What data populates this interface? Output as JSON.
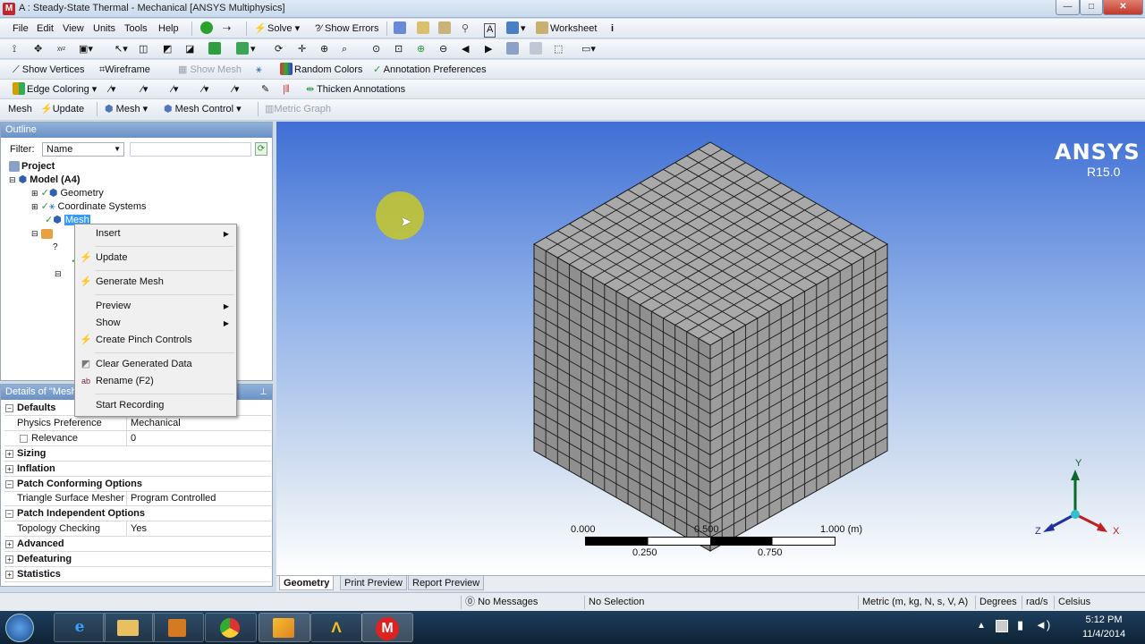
{
  "window": {
    "title": "A : Steady-State Thermal - Mechanical [ANSYS Multiphysics]",
    "minimize": "—",
    "maximize": "□",
    "close": "✕"
  },
  "menu": [
    "File",
    "Edit",
    "View",
    "Units",
    "Tools",
    "Help"
  ],
  "toolbar1": {
    "solve": "Solve",
    "show_errors": "Show Errors",
    "worksheet": "Worksheet"
  },
  "toolbar3": {
    "show_vertices": "Show Vertices",
    "wireframe": "Wireframe",
    "show_mesh": "Show Mesh",
    "random_colors": "Random Colors",
    "annotation_prefs": "Annotation Preferences"
  },
  "toolbar4": {
    "edge_coloring": "Edge Coloring",
    "thicken": "Thicken Annotations"
  },
  "toolbar5": {
    "mesh": "Mesh",
    "update": "Update",
    "mesh_dd": "Mesh",
    "mesh_control": "Mesh Control",
    "metric_graph": "Metric Graph"
  },
  "outline": {
    "header": "Outline",
    "filter_label": "Filter:",
    "filter_value": "Name",
    "tree": {
      "project": "Project",
      "model": "Model (A4)",
      "geometry": "Geometry",
      "coord": "Coordinate Systems",
      "mesh": "Mesh"
    }
  },
  "context_menu": {
    "insert": "Insert",
    "update": "Update",
    "generate_mesh": "Generate Mesh",
    "preview": "Preview",
    "show": "Show",
    "create_pinch": "Create Pinch Controls",
    "clear_generated": "Clear Generated Data",
    "rename": "Rename (F2)",
    "start_recording": "Start Recording"
  },
  "details": {
    "header": "Details of \"Mesh\"",
    "rows": [
      {
        "label": "Defaults",
        "group": true,
        "sign": "−"
      },
      {
        "label": "Physics Preference",
        "value": "Mechanical"
      },
      {
        "label": "Relevance",
        "value": "0"
      },
      {
        "label": "Sizing",
        "group": true,
        "sign": "+"
      },
      {
        "label": "Inflation",
        "group": true,
        "sign": "+"
      },
      {
        "label": "Patch Conforming Options",
        "group": true,
        "sign": "−"
      },
      {
        "label": "Triangle Surface Mesher",
        "value": "Program Controlled"
      },
      {
        "label": "Patch Independent Options",
        "group": true,
        "sign": "−"
      },
      {
        "label": "Topology Checking",
        "value": "Yes"
      },
      {
        "label": "Advanced",
        "group": true,
        "sign": "+"
      },
      {
        "label": "Defeaturing",
        "group": true,
        "sign": "+"
      },
      {
        "label": "Statistics",
        "group": true,
        "sign": "+"
      }
    ]
  },
  "viewport": {
    "brand": "ANSYS",
    "version": "R15.0",
    "scale_labels_top": [
      "0.000",
      "0.500",
      "1.000 (m)"
    ],
    "scale_labels_bottom": [
      "0.250",
      "0.750"
    ],
    "axes": {
      "x": "X",
      "y": "Y",
      "z": "Z"
    }
  },
  "tabs": [
    "Geometry",
    "Print Preview",
    "Report Preview"
  ],
  "status": {
    "messages": "No Messages",
    "selection": "No Selection",
    "units": "Metric (m, kg, N, s, V, A)",
    "angle": "Degrees",
    "rate": "rad/s",
    "temp": "Celsius"
  },
  "taskbar": {
    "time": "5:12 PM",
    "date": "11/4/2014",
    "apps": [
      "start-orb",
      "internet-explorer",
      "file-explorer",
      "media-player",
      "chrome",
      "ansys-workbench",
      "ansys-mechanical",
      "mega"
    ]
  }
}
